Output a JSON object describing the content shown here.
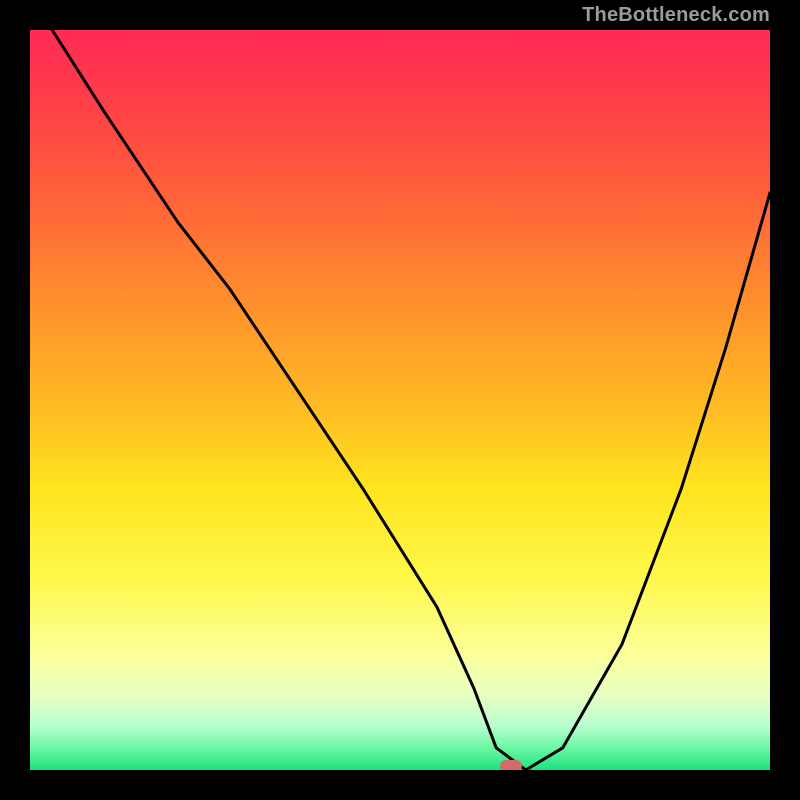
{
  "watermark": "TheBottleneck.com",
  "chart_data": {
    "type": "line",
    "title": "",
    "xlabel": "",
    "ylabel": "",
    "xlim": [
      0,
      100
    ],
    "ylim": [
      0,
      100
    ],
    "grid": false,
    "legend": false,
    "marker": {
      "x": 65,
      "y": 0,
      "color": "#d46a6a"
    },
    "series": [
      {
        "name": "curve",
        "stroke": "#000000",
        "x": [
          3,
          10,
          20,
          27,
          35,
          45,
          55,
          60,
          63,
          67,
          72,
          80,
          88,
          94,
          100
        ],
        "y": [
          100,
          89,
          74,
          65,
          53,
          38,
          22,
          11,
          3,
          0,
          3,
          17,
          38,
          57,
          78
        ]
      }
    ]
  }
}
